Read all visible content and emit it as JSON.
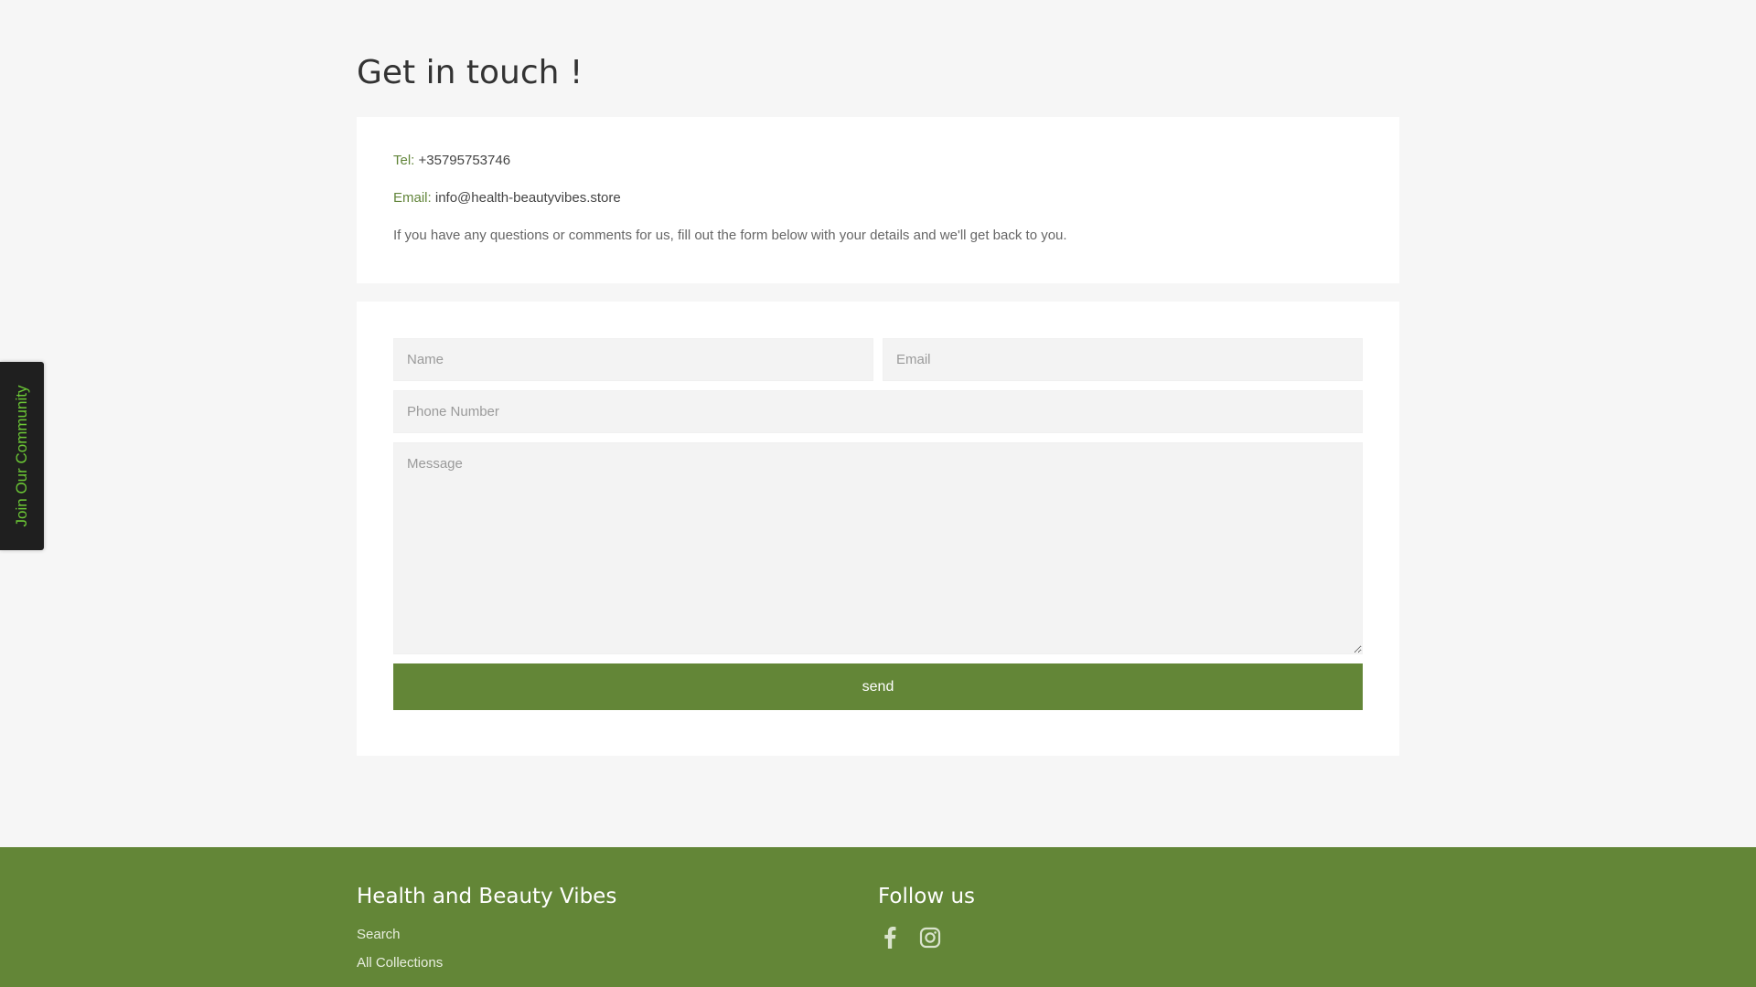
{
  "page": {
    "title": "Get in touch !"
  },
  "contact_info": {
    "tel_label": "Tel:",
    "tel_value": "+35795753746",
    "email_label": "Email:",
    "email_value": "info@health-beautyvibes.store",
    "description": "If you have any questions or comments for us, fill out the form below with your details and we'll get back to you."
  },
  "form": {
    "name_placeholder": "Name",
    "email_placeholder": "Email",
    "phone_placeholder": "Phone Number",
    "message_placeholder": "Message",
    "send_label": "send"
  },
  "side_tab": {
    "label": "Join Our Community",
    "text_color": "#6bc735"
  },
  "footer": {
    "brand_heading": "Health and Beauty Vibes",
    "links": [
      "Search",
      "All Collections"
    ],
    "follow_heading": "Follow us",
    "social": [
      "facebook-icon",
      "instagram-icon"
    ]
  },
  "colors": {
    "accent": "#638637",
    "background": "#f6f6f6",
    "card": "#ffffff",
    "field": "#f3f3f3"
  }
}
